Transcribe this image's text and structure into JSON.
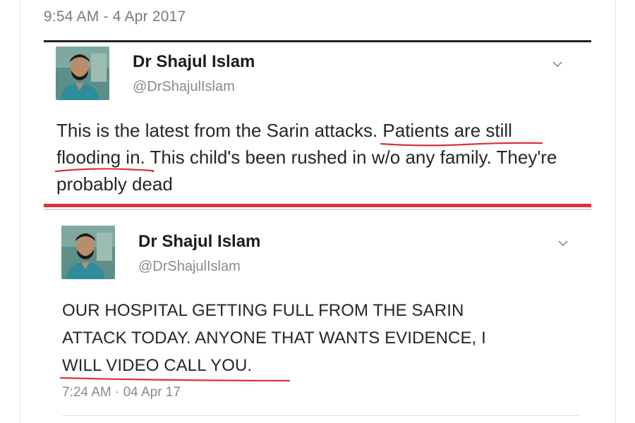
{
  "header": {
    "timestamp": "9:54 AM - 4 Apr 2017"
  },
  "tweets": [
    {
      "author_name": "Dr Shajul Islam",
      "author_handle": "@DrShajulIslam",
      "text_before": "This is the latest from the Sarin attacks. ",
      "text_highlight_1": "Patients are still",
      "text_highlight_2": "flooding in",
      "text_after": ". This child's been rushed in w/o any family. They're probably dead"
    },
    {
      "author_name": "Dr Shajul Islam",
      "author_handle": "@DrShajulIslam",
      "text_line_1": "OUR HOSPITAL GETTING FULL FROM THE SARIN",
      "text_line_2": "ATTACK TODAY. ANYONE THAT WANTS EVIDENCE, I",
      "text_highlight": "WILL VIDEO CALL YOU.",
      "timestamp": "7:24 AM · 04 Apr 17"
    }
  ],
  "colors": {
    "highlight_red": "#d9343a",
    "separator_dark": "#222222",
    "text_gray": "#8a8a8a"
  },
  "icons": {
    "menu_caret": "chevron-down-icon",
    "profile_photo": "avatar"
  }
}
